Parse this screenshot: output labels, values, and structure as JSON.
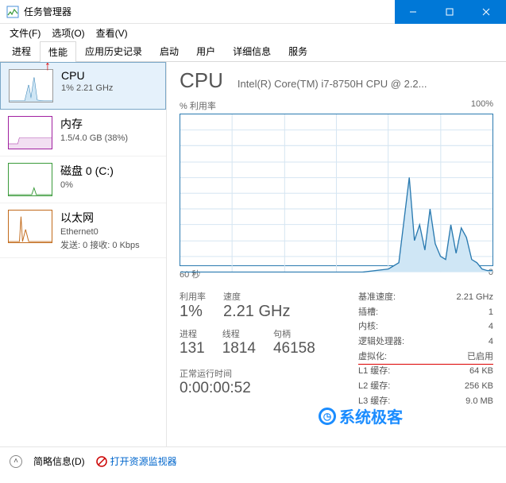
{
  "window": {
    "title": "任务管理器"
  },
  "menu": {
    "file": "文件(F)",
    "options": "选项(O)",
    "view": "查看(V)"
  },
  "tabs": [
    "进程",
    "性能",
    "应用历史记录",
    "启动",
    "用户",
    "详细信息",
    "服务"
  ],
  "active_tab_index": 1,
  "sidebar": {
    "items": [
      {
        "name": "CPU",
        "sub": "1% 2.21 GHz",
        "color": "#2a7ab0"
      },
      {
        "name": "内存",
        "sub": "1.5/4.0 GB (38%)",
        "color": "#a020a0"
      },
      {
        "name": "磁盘 0 (C:)",
        "sub": "0%",
        "color": "#3a9a3a"
      },
      {
        "name": "以太网",
        "sub1": "Ethernet0",
        "sub2": "发送: 0 接收: 0 Kbps",
        "color": "#c26a1a"
      }
    ]
  },
  "main": {
    "title": "CPU",
    "subtitle": "Intel(R) Core(TM) i7-8750H CPU @ 2.2...",
    "chart_ylabel": "% 利用率",
    "chart_ymax": "100%",
    "chart_xleft": "60 秒",
    "chart_xright": "0",
    "stats": {
      "util_lbl": "利用率",
      "util": "1%",
      "speed_lbl": "速度",
      "speed": "2.21 GHz",
      "proc_lbl": "进程",
      "proc": "131",
      "thread_lbl": "线程",
      "thread": "1814",
      "handle_lbl": "句柄",
      "handle": "46158",
      "uptime_lbl": "正常运行时间",
      "uptime": "0:00:00:52"
    },
    "right": {
      "base_lbl": "基准速度:",
      "base": "2.21 GHz",
      "sockets_lbl": "插槽:",
      "sockets": "1",
      "cores_lbl": "内核:",
      "cores": "4",
      "lproc_lbl": "逻辑处理器:",
      "lproc": "4",
      "virt_lbl": "虚拟化:",
      "virt": "已启用",
      "l1_lbl": "L1 缓存:",
      "l1": "64 KB",
      "l2_lbl": "L2 缓存:",
      "l2": "256 KB",
      "l3_lbl": "L3 缓存:",
      "l3": "9.0 MB"
    }
  },
  "chart_data": {
    "type": "line",
    "title": "% 利用率",
    "xlabel": "秒",
    "ylabel": "%",
    "xlim": [
      60,
      0
    ],
    "ylim": [
      0,
      100
    ],
    "x": [
      60,
      55,
      50,
      45,
      40,
      35,
      30,
      25,
      20,
      18,
      16,
      15,
      14,
      13,
      12,
      11,
      10,
      9,
      8,
      7,
      6,
      5,
      4,
      3,
      2,
      1,
      0
    ],
    "values": [
      0,
      0,
      0,
      0,
      0,
      0,
      0,
      0,
      2,
      6,
      60,
      20,
      30,
      14,
      40,
      18,
      10,
      8,
      30,
      12,
      28,
      22,
      8,
      6,
      2,
      1,
      1
    ]
  },
  "bottom": {
    "brief": "简略信息(D)",
    "resmon": "打开资源监视器"
  },
  "watermark": "系统极客"
}
